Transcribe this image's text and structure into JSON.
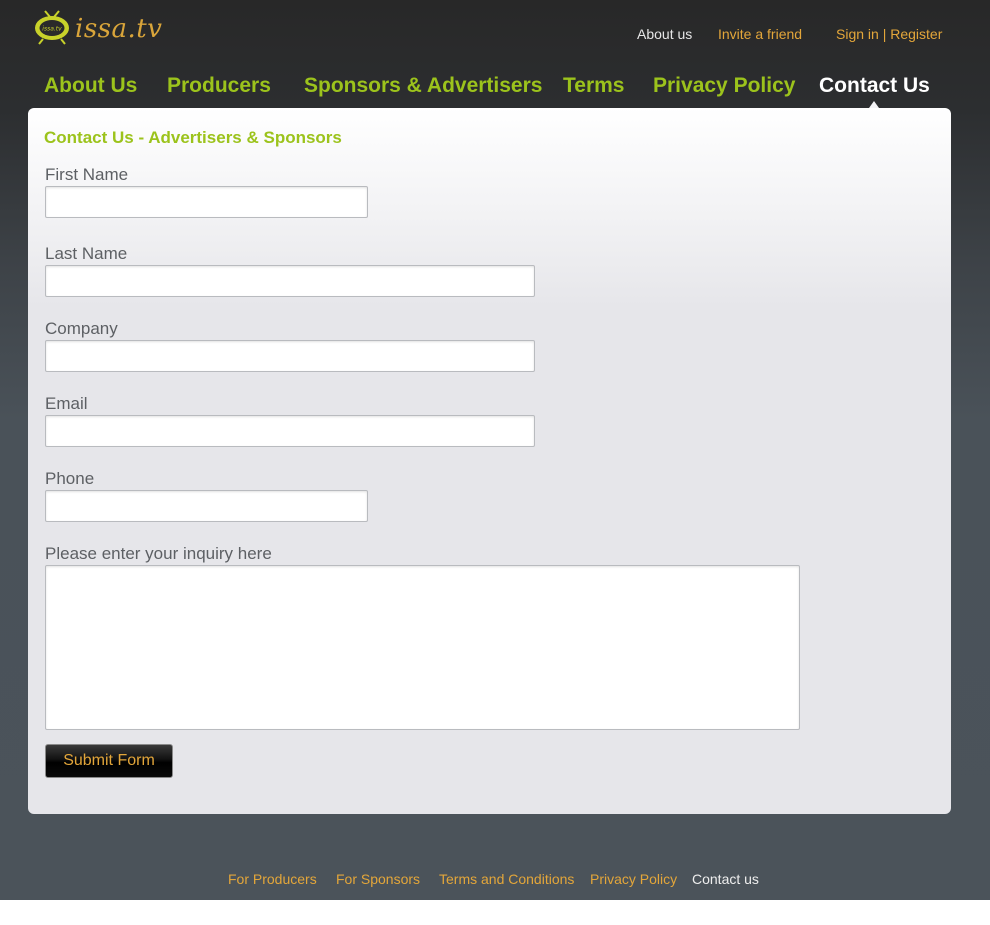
{
  "brand": {
    "logo_text": "issa.tv",
    "logo_badge": "issa.tv"
  },
  "top_links": {
    "about": "About us",
    "invite": "Invite a friend",
    "signin": "Sign in",
    "separator": " | ",
    "register": "Register"
  },
  "nav": {
    "items": [
      {
        "label": "About Us",
        "active": false
      },
      {
        "label": "Producers",
        "active": false
      },
      {
        "label": "Sponsors & Advertisers",
        "active": false
      },
      {
        "label": "Terms",
        "active": false
      },
      {
        "label": "Privacy Policy",
        "active": false
      },
      {
        "label": "Contact Us",
        "active": true
      }
    ]
  },
  "form": {
    "title": "Contact Us - Advertisers & Sponsors",
    "fields": {
      "first_name": {
        "label": "First Name",
        "value": ""
      },
      "last_name": {
        "label": "Last Name",
        "value": ""
      },
      "company": {
        "label": "Company",
        "value": ""
      },
      "email": {
        "label": "Email",
        "value": ""
      },
      "phone": {
        "label": "Phone",
        "value": ""
      },
      "inquiry": {
        "label": "Please enter your inquiry here",
        "value": ""
      }
    },
    "submit_label": "Submit Form"
  },
  "footer": {
    "links": [
      {
        "label": "For Producers"
      },
      {
        "label": "For Sponsors"
      },
      {
        "label": "Terms and Conditions"
      },
      {
        "label": "Privacy Policy"
      },
      {
        "label": "Contact us"
      }
    ]
  },
  "colors": {
    "accent_green": "#9cc31c",
    "accent_orange": "#e3a63a",
    "active_white": "#ffffff"
  }
}
